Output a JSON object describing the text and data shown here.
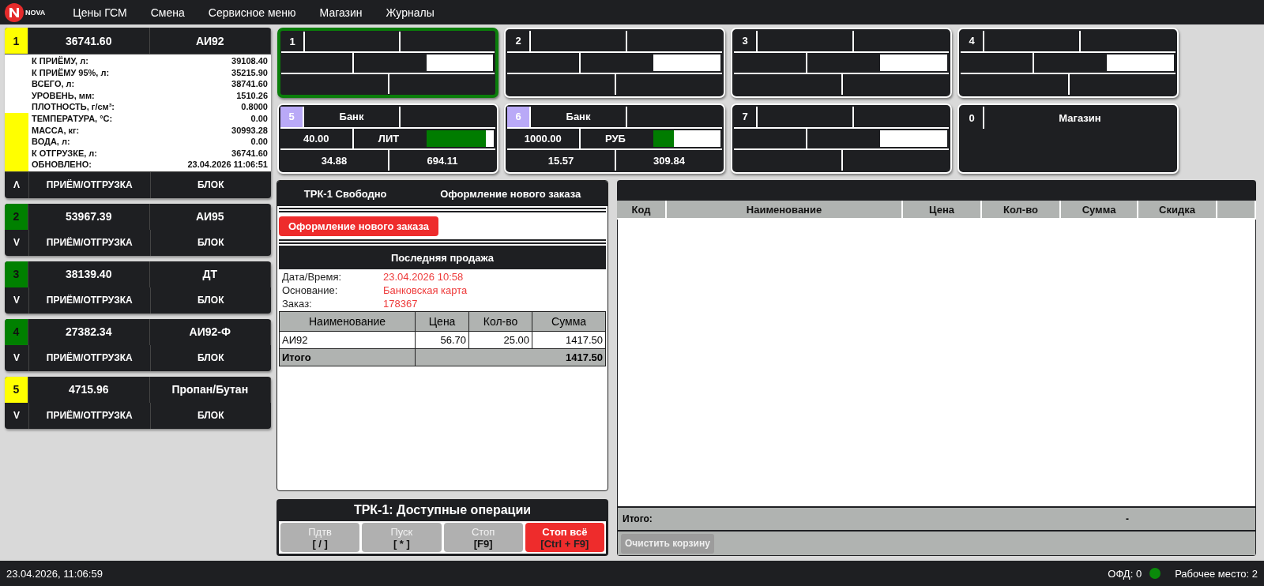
{
  "menu": {
    "logo_text": "NOVA",
    "items": [
      "Цены ГСМ",
      "Смена",
      "Сервисное меню",
      "Магазин",
      "Журналы"
    ]
  },
  "tanks": [
    {
      "number": "1",
      "color": "#ffff00",
      "volume": "36741.60",
      "fuel": "АИ92",
      "expanded": true,
      "toggle": "Λ",
      "level": 0.5,
      "details": [
        {
          "label": "К ПРИЁМУ, л:",
          "value": "39108.40"
        },
        {
          "label": "К ПРИЁМУ 95%, л:",
          "value": "35215.90"
        },
        {
          "label": "ВСЕГО, л:",
          "value": "38741.60"
        },
        {
          "label": "УРОВЕНЬ, мм:",
          "value": "1510.26"
        },
        {
          "label": "ПЛОТНОСТЬ, г/см³:",
          "value": "0.8000"
        },
        {
          "label": "ТЕМПЕРАТУРА, °С:",
          "value": "0.00"
        },
        {
          "label": "МАССА, кг:",
          "value": "30993.28"
        },
        {
          "label": "ВОДА, л:",
          "value": "0.00"
        },
        {
          "label": "К ОТГРУЗКЕ, л:",
          "value": "36741.60"
        },
        {
          "label": "ОБНОВЛЕНО:",
          "value": "23.04.2026 11:06:51"
        }
      ],
      "action": "ПРИЁМ/ОТГРУЗКА",
      "block": "БЛОК"
    },
    {
      "number": "2",
      "color": "#008000",
      "volume": "53967.39",
      "fuel": "АИ95",
      "expanded": false,
      "toggle": "V",
      "action": "ПРИЁМ/ОТГРУЗКА",
      "block": "БЛОК"
    },
    {
      "number": "3",
      "color": "#008000",
      "volume": "38139.40",
      "fuel": "ДТ",
      "expanded": false,
      "toggle": "V",
      "action": "ПРИЁМ/ОТГРУЗКА",
      "block": "БЛОК"
    },
    {
      "number": "4",
      "color": "#008000",
      "volume": "27382.34",
      "fuel": "АИ92-Ф",
      "expanded": false,
      "toggle": "V",
      "action": "ПРИЁМ/ОТГРУЗКА",
      "block": "БЛОК"
    },
    {
      "number": "5",
      "color": "#ffff00",
      "volume": "4715.96",
      "fuel": "Пропан/Бутан",
      "expanded": false,
      "toggle": "V",
      "action": "ПРИЁМ/ОТГРУЗКА",
      "block": "БЛОК"
    }
  ],
  "pumps": [
    {
      "kind": "pump",
      "number": "1",
      "color": "#1e1f22",
      "selected": true
    },
    {
      "kind": "pump",
      "number": "2",
      "color": "#1e1f22",
      "selected": false
    },
    {
      "kind": "pump",
      "number": "3",
      "color": "#1e1f22",
      "selected": false
    },
    {
      "kind": "pump",
      "number": "4",
      "color": "#1e1f22",
      "selected": false
    },
    {
      "kind": "pump",
      "number": "5",
      "color": "#b9a9f7",
      "selected": false,
      "payment": "Банк",
      "amount": "40.00",
      "unit": "ЛИТ",
      "level": 0.88,
      "volume": "34.88",
      "sum": "694.11"
    },
    {
      "kind": "pump",
      "number": "6",
      "color": "#b9a9f7",
      "selected": false,
      "payment": "Банк",
      "amount": "1000.00",
      "unit": "РУБ",
      "level": 0.3,
      "volume": "15.57",
      "sum": "309.84"
    },
    {
      "kind": "pump",
      "number": "7",
      "color": "#1e1f22",
      "selected": false
    },
    {
      "kind": "shop",
      "number": "0",
      "color": "#1e1f22",
      "selected": false,
      "title": "Магазин"
    }
  ],
  "order_panel": {
    "status": "ТРК-1 Свободно",
    "mode": "Оформление нового заказа",
    "new_order_button": "Оформление нового заказа",
    "last_sale_title": "Последняя продажа",
    "info": [
      {
        "label": "Дата/Время:",
        "value": "23.04.2026 10:58"
      },
      {
        "label": "Основание:",
        "value": "Банковская карта"
      },
      {
        "label": "Заказ:",
        "value": "178367"
      }
    ],
    "columns": [
      "Наименование",
      "Цена",
      "Кол-во",
      "Сумма"
    ],
    "rows": [
      [
        "АИ92",
        "56.70",
        "25.00",
        "1417.50"
      ]
    ],
    "total_label": "Итого",
    "total_value": "1417.50"
  },
  "operations": {
    "title": "ТРК-1: Доступные операции",
    "buttons": [
      {
        "label": "Пдтв",
        "key": "[ / ]",
        "kind": "normal",
        "disabled": true
      },
      {
        "label": "Пуск",
        "key": "[ * ]",
        "kind": "normal",
        "disabled": true
      },
      {
        "label": "Стоп",
        "key": "[F9]",
        "kind": "normal",
        "disabled": true
      },
      {
        "label": "Стоп всё",
        "key": "[Ctrl + F9]",
        "kind": "danger",
        "disabled": false
      }
    ]
  },
  "cart": {
    "columns": [
      "Код",
      "Наименование",
      "Цена",
      "Кол-во",
      "Сумма",
      "Скидка"
    ],
    "total_label": "Итого:",
    "total_value": "-",
    "clear_button": "Очистить корзину"
  },
  "status_bar": {
    "datetime": "23.04.2026, 11:06:59",
    "ofd": "ОФД: 0",
    "ofd_online": true,
    "workplace": "Рабочее место: 2"
  }
}
